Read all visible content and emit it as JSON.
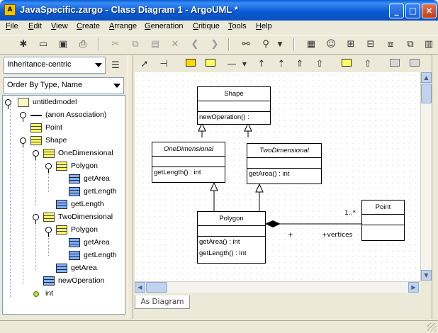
{
  "window": {
    "title": "JavaSpecific.zargo - Class Diagram 1 - ArgoUML *"
  },
  "menu": [
    "File",
    "Edit",
    "View",
    "Create",
    "Arrange",
    "Generation",
    "Critique",
    "Tools",
    "Help"
  ],
  "explorer": {
    "perspective": "Inheritance-centric",
    "order": "Order By Type, Name",
    "tree": [
      {
        "label": "untitledmodel"
      },
      {
        "label": "(anon Association)"
      },
      {
        "label": "Point"
      },
      {
        "label": "Shape"
      },
      {
        "label": "OneDimensional"
      },
      {
        "label": "Polygon"
      },
      {
        "label": "getArea"
      },
      {
        "label": "getLength"
      },
      {
        "label": "getLength"
      },
      {
        "label": "TwoDimensional"
      },
      {
        "label": "Polygon"
      },
      {
        "label": "getArea"
      },
      {
        "label": "getLength"
      },
      {
        "label": "getArea"
      },
      {
        "label": "newOperation"
      },
      {
        "label": "int"
      }
    ]
  },
  "diagram": {
    "shape": {
      "name": "Shape",
      "op": "newOperation() :"
    },
    "one_dim": {
      "name": "OneDimensional",
      "op": "getLength() : int"
    },
    "two_dim": {
      "name": "TwoDimensional",
      "op": "getArea() : int"
    },
    "polygon": {
      "name": "Polygon",
      "op1": "getArea() : int",
      "op2": "getLength() : int"
    },
    "point": {
      "name": "Point"
    },
    "assoc": {
      "multiplicity": "1..*",
      "end_plus": "+",
      "role": "+vertices"
    }
  },
  "tabs": {
    "as_diagram": "As Diagram"
  },
  "colors": {
    "class_fill": "#ffff66",
    "title_bar": "#0b5bd3"
  }
}
